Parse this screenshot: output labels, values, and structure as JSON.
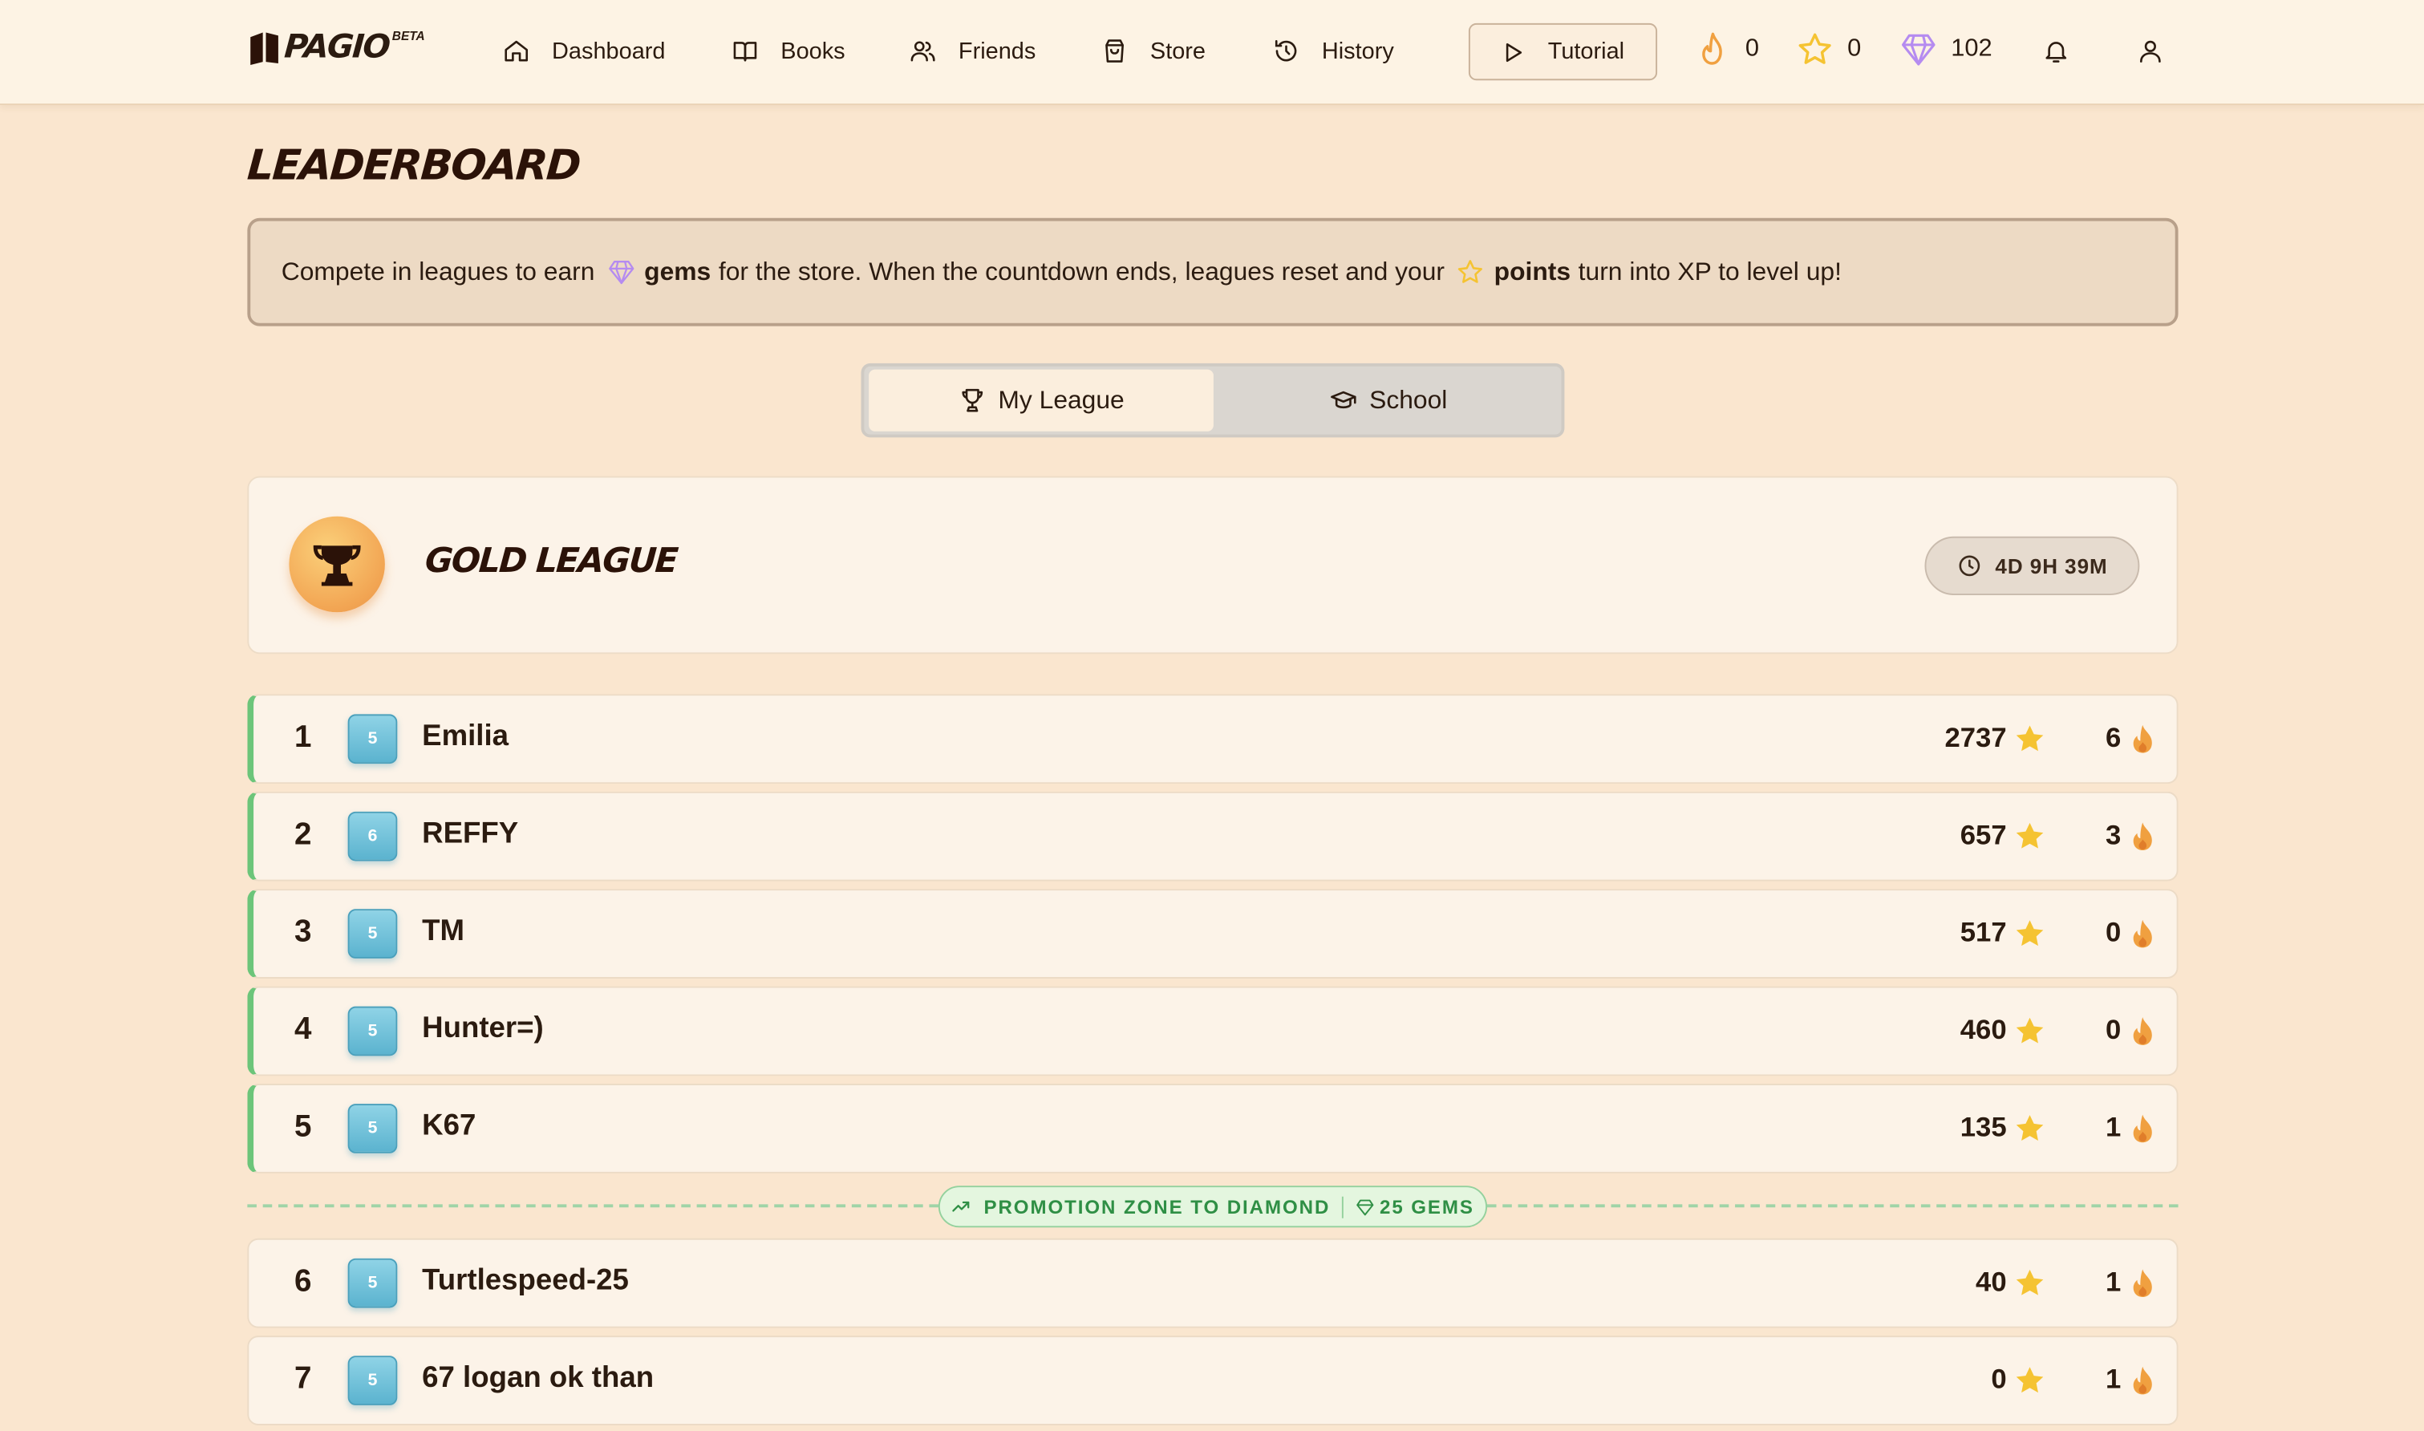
{
  "app": {
    "logo": "PAGIO",
    "beta": "BETA"
  },
  "nav": {
    "dashboard": "Dashboard",
    "books": "Books",
    "friends": "Friends",
    "store": "Store",
    "history": "History",
    "tutorial": "Tutorial",
    "streak": "0",
    "points": "0",
    "gems": "102"
  },
  "page": {
    "title": "LEADERBOARD",
    "info": {
      "part1": "Compete in leagues to earn",
      "gems": "gems",
      "part2": "for the store. When the countdown ends, leagues reset and your",
      "points": "points",
      "part3": "turn into XP to level up!"
    }
  },
  "toggle": {
    "league": "My League",
    "school": "School"
  },
  "league": {
    "name": "GOLD LEAGUE",
    "countdown": "4D 9H 39M"
  },
  "promotion": {
    "label": "PROMOTION ZONE TO DIAMOND",
    "reward": "25 GEMS"
  },
  "players": [
    {
      "rank": "1",
      "level": "5",
      "name": "Emilia",
      "points": "2737",
      "streak": "6"
    },
    {
      "rank": "2",
      "level": "6",
      "name": "REFFY",
      "points": "657",
      "streak": "3"
    },
    {
      "rank": "3",
      "level": "5",
      "name": "TM",
      "points": "517",
      "streak": "0"
    },
    {
      "rank": "4",
      "level": "5",
      "name": "Hunter=)",
      "points": "460",
      "streak": "0"
    },
    {
      "rank": "5",
      "level": "5",
      "name": "K67",
      "points": "135",
      "streak": "1"
    },
    {
      "rank": "6",
      "level": "5",
      "name": "Turtlespeed-25",
      "points": "40",
      "streak": "1"
    },
    {
      "rank": "7",
      "level": "5",
      "name": "67 logan ok than",
      "points": "0",
      "streak": "1"
    }
  ],
  "colors": {
    "background": "#fae6cf",
    "promotion_accent": "#6cc57a",
    "star": "#f5c332",
    "flame": "#f0a040",
    "gem": "#b58bf0"
  },
  "icons": {
    "nav": [
      "home-icon",
      "book-icon",
      "friends-icon",
      "store-bag-icon",
      "history-icon",
      "play-icon",
      "flame-icon",
      "star-icon",
      "gem-icon",
      "bell-icon",
      "user-icon"
    ]
  }
}
